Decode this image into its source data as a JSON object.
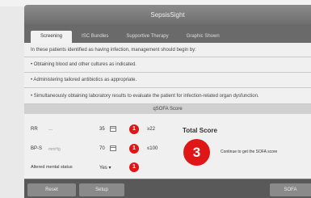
{
  "app": {
    "title": "SepsisSight"
  },
  "tabs": [
    {
      "label": "Screening",
      "active": true
    },
    {
      "label": "ISC Bundles",
      "active": false
    },
    {
      "label": "Supportive Therapy",
      "active": false
    },
    {
      "label": "Graphic Shown",
      "active": false
    }
  ],
  "instructions": {
    "intro": "In these patients identified as having infection, management should begin by:",
    "items": [
      "• Obtaining blood and other cultures as indicated.",
      "• Administering tailored antibiotics as appropriate.",
      "• Simultaneously obtaining laboratory results to evaluate the patient for infection-related organ dysfunction."
    ]
  },
  "qsofa": {
    "header": "qSOFA Score",
    "criteria": [
      {
        "label": "RR",
        "unit": "—",
        "value": "35",
        "mark": "1",
        "threshold": "≥22"
      },
      {
        "label": "BP-S",
        "unit": "mmHg",
        "value": "70",
        "mark": "1",
        "threshold": "≤100"
      },
      {
        "label": "Altered mental status",
        "value": "Yes ▾",
        "mark": "1"
      }
    ],
    "total_label": "Total Score",
    "total_value": "3",
    "message": "Continue to get the SOFA score",
    "accent_color": "#e01515"
  },
  "footer": {
    "reset": "Reset",
    "setup": "Setup",
    "sofa": "SOFA"
  }
}
